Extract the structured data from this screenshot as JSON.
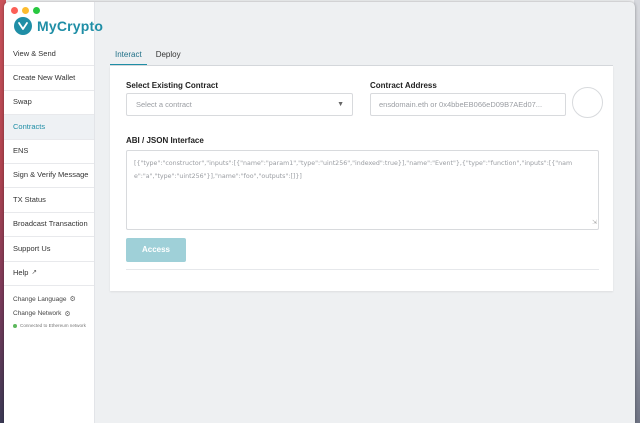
{
  "app": {
    "name": "MyCrypto"
  },
  "sidebar": {
    "items": [
      {
        "label": "View & Send"
      },
      {
        "label": "Create New Wallet"
      },
      {
        "label": "Swap"
      },
      {
        "label": "Contracts"
      },
      {
        "label": "ENS"
      },
      {
        "label": "Sign & Verify Message"
      },
      {
        "label": "TX Status"
      },
      {
        "label": "Broadcast Transaction"
      },
      {
        "label": "Support Us"
      },
      {
        "label": "Help"
      }
    ],
    "active_index": 3,
    "change_language": "Change Language",
    "change_network": "Change Network",
    "network_status": "Connected to Ethereum network"
  },
  "tabs": [
    {
      "label": "Interact"
    },
    {
      "label": "Deploy"
    }
  ],
  "form": {
    "select_contract_label": "Select Existing Contract",
    "select_contract_placeholder": "Select a contract",
    "address_label": "Contract Address",
    "address_placeholder": "ensdomain.eth or 0x4bbeEB066eD09B7AEd07...",
    "abi_label": "ABI / JSON Interface",
    "abi_placeholder": "[{\"type\":\"constructor\",\"inputs\":[{\"name\":\"param1\",\"type\":\"uint256\",\"indexed\":true}],\"name\":\"Event\"},{\"type\":\"function\",\"inputs\":[{\"name\":\"a\",\"type\":\"uint256\"}],\"name\":\"foo\",\"outputs\":[]}]",
    "access_button": "Access"
  },
  "colors": {
    "brand": "#1f8ea6",
    "access_button": "#9fd0d8",
    "status_ok": "#5cb85c"
  }
}
